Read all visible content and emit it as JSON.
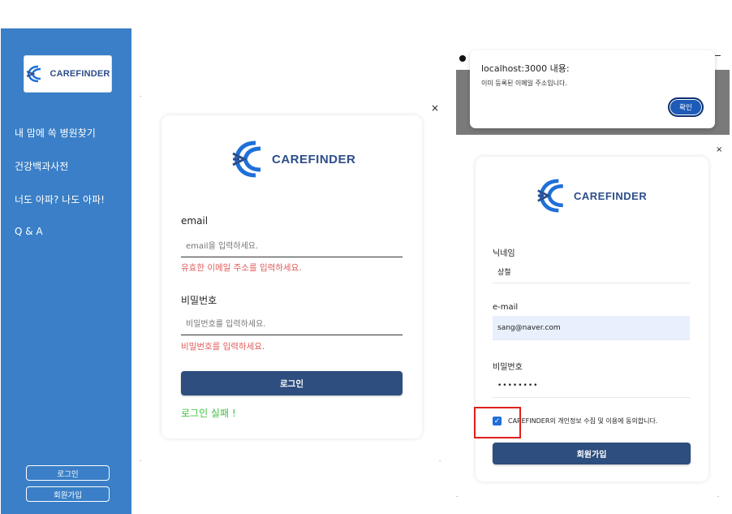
{
  "sidebar": {
    "logo_text": "CAREFINDER",
    "nav_items": [
      {
        "label": "내 맘에 쏙 병원찾기"
      },
      {
        "label": "건강백과사전"
      },
      {
        "label": "너도 아파? 나도 아파!"
      },
      {
        "label": "Q & A"
      }
    ],
    "login_button": "로그인",
    "signup_button": "회원가입"
  },
  "login_modal": {
    "close_icon": "×",
    "logo_text": "CAREFINDER",
    "email_label": "email",
    "email_placeholder": "email을 입력하세요.",
    "email_error": "유효한 이메일 주소를 입력하세요.",
    "password_label": "비밀번호",
    "password_placeholder": "비밀번호를 입력하세요.",
    "password_error": "비밀번호를 입력하세요.",
    "submit_label": "로그인",
    "failure_message": "로그인 실패 !"
  },
  "alert_dialog": {
    "title": "localhost:3000 내용:",
    "message": "이미 등록된 이메일 주소입니다.",
    "ok_label": "확인"
  },
  "signup_modal": {
    "close_icon": "×",
    "logo_text": "CAREFINDER",
    "nickname_label": "닉네임",
    "nickname_value": "상철",
    "email_label": "e-mail",
    "email_value": "sang@naver.com",
    "password_label": "비밀번호",
    "password_value": "••••••••",
    "agree_checked": true,
    "agree_text": "CAREFINDER의 개인정보 수집 및 이용에 동의합니다.",
    "submit_label": "회원가입"
  },
  "colors": {
    "sidebar_bg": "#3a7fc7",
    "primary_button": "#2d4e7e",
    "error_text": "#e25b5b",
    "failure_text": "#3fbf3f",
    "logo_blue": "#1e6fd9",
    "highlight_box": "#e0201d"
  }
}
